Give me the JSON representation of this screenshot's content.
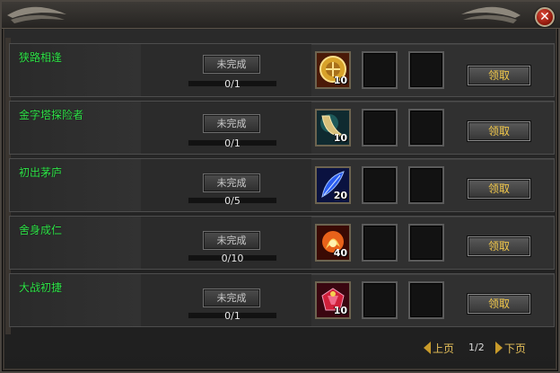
{
  "window": {
    "close_icon": "close-icon"
  },
  "quests": [
    {
      "name": "狭路相逢",
      "status": "未完成",
      "progress": "0/1",
      "reward_icon": "gold-medal-icon",
      "reward_count": "10",
      "claim_label": "领取"
    },
    {
      "name": "金字塔探险者",
      "status": "未完成",
      "progress": "0/1",
      "reward_icon": "crescent-ring-icon",
      "reward_count": "10",
      "claim_label": "领取"
    },
    {
      "name": "初出茅庐",
      "status": "未完成",
      "progress": "0/5",
      "reward_icon": "blue-feather-icon",
      "reward_count": "20",
      "claim_label": "领取"
    },
    {
      "name": "舍身成仁",
      "status": "未完成",
      "progress": "0/10",
      "reward_icon": "fire-orb-icon",
      "reward_count": "40",
      "claim_label": "领取"
    },
    {
      "name": "大战初捷",
      "status": "未完成",
      "progress": "0/1",
      "reward_icon": "red-gem-box-icon",
      "reward_count": "10",
      "claim_label": "领取"
    }
  ],
  "pager": {
    "prev_label": "上页",
    "page": "1/2",
    "next_label": "下页"
  },
  "colors": {
    "quest_name": "#31e44a",
    "claim_text": "#f2c84a",
    "pager_text": "#e6c05a"
  }
}
